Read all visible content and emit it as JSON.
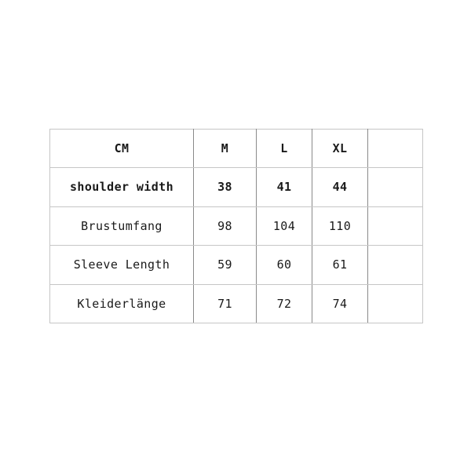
{
  "chart_data": {
    "type": "table",
    "title": "",
    "unit_label": "CM",
    "columns": [
      "CM",
      "M",
      "L",
      "XL",
      ""
    ],
    "rows": [
      {
        "label": "shoulder width",
        "values": [
          "38",
          "41",
          "44",
          ""
        ],
        "emphasis": true
      },
      {
        "label": "Brustumfang",
        "values": [
          "98",
          "104",
          "110",
          ""
        ],
        "emphasis": false
      },
      {
        "label": "Sleeve Length",
        "values": [
          "59",
          "60",
          "61",
          ""
        ],
        "emphasis": false
      },
      {
        "label": "Kleiderlänge",
        "values": [
          "71",
          "72",
          "74",
          ""
        ],
        "emphasis": false
      }
    ],
    "sizes": [
      "M",
      "L",
      "XL"
    ],
    "series": [
      {
        "name": "shoulder width",
        "values": [
          38,
          41,
          44
        ]
      },
      {
        "name": "Brustumfang",
        "values": [
          98,
          104,
          110
        ]
      },
      {
        "name": "Sleeve Length",
        "values": [
          59,
          60,
          61
        ]
      },
      {
        "name": "Kleiderlänge",
        "values": [
          71,
          72,
          74
        ]
      }
    ],
    "grid": true,
    "legend": "none",
    "colors": {
      "background": "#ffffff",
      "text": "#1a1a1a",
      "border_horizontal": "#c6c6c6",
      "border_vertical": "#8a8a8a"
    }
  },
  "table": {
    "header": {
      "unit": "CM",
      "size_m": "M",
      "size_l": "L",
      "size_xl": "XL",
      "blank": ""
    },
    "rows": {
      "r0": {
        "label": "shoulder width",
        "m": "38",
        "l": "41",
        "xl": "44",
        "blank": ""
      },
      "r1": {
        "label": "Brustumfang",
        "m": "98",
        "l": "104",
        "xl": "110",
        "blank": ""
      },
      "r2": {
        "label": "Sleeve Length",
        "m": "59",
        "l": "60",
        "xl": "61",
        "blank": ""
      },
      "r3": {
        "label": "Kleiderlänge",
        "m": "71",
        "l": "72",
        "xl": "74",
        "blank": ""
      }
    }
  }
}
